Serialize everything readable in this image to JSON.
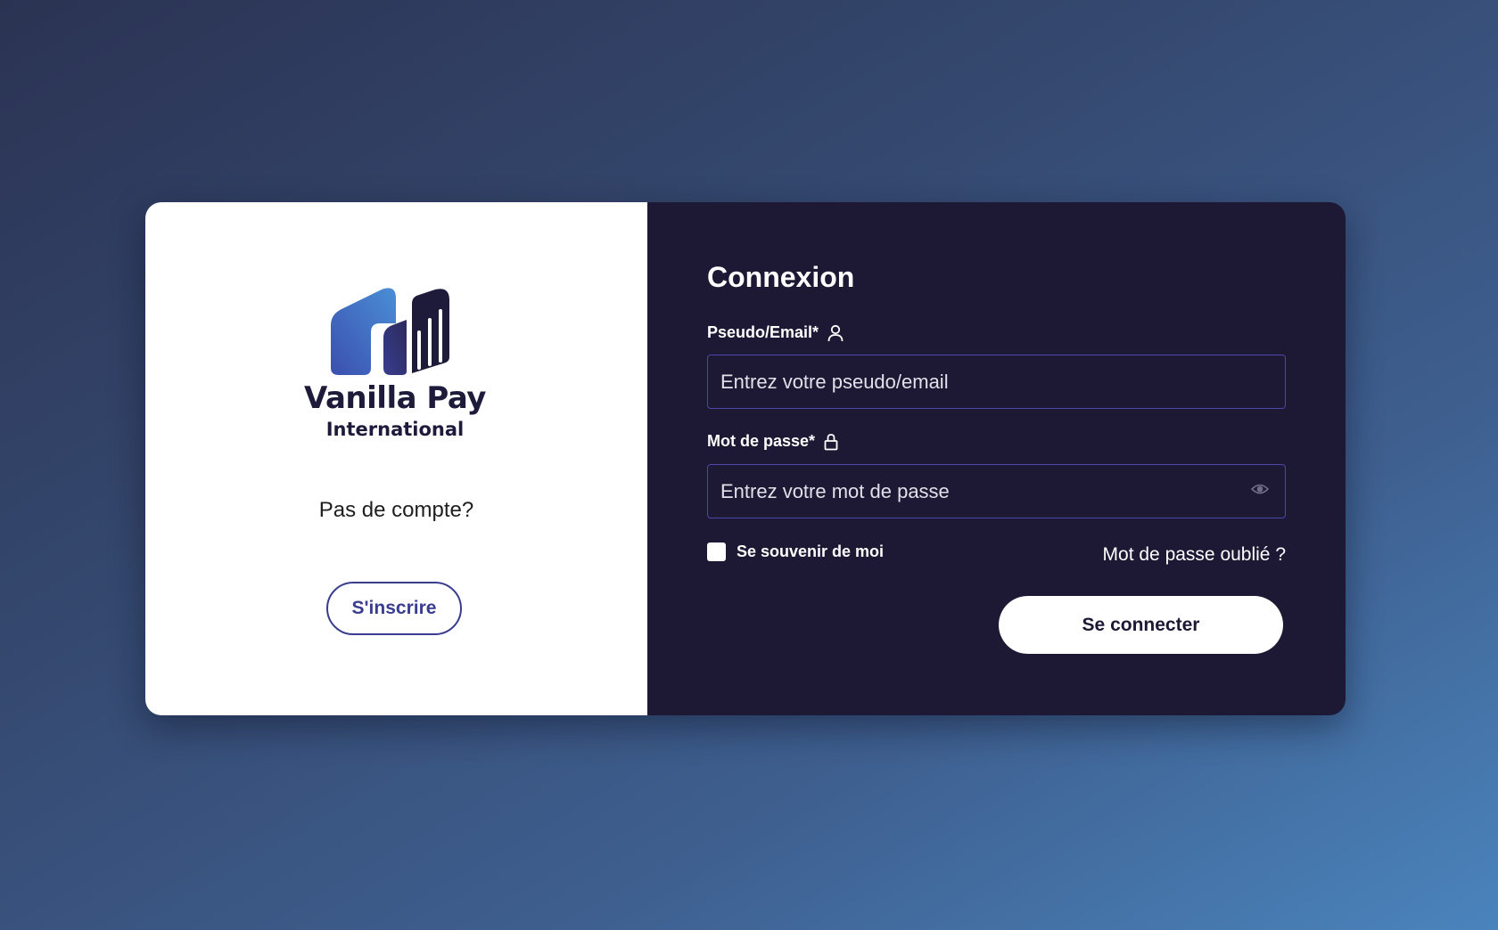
{
  "brand": {
    "name": "Vanilla Pay",
    "subtitle": "International",
    "logo_icon": "bar-chart-logo-icon"
  },
  "signup_panel": {
    "prompt": "Pas de compte?",
    "signup_label": "S'inscrire"
  },
  "login": {
    "title": "Connexion",
    "username_label": "Pseudo/Email*",
    "username_icon": "user-icon",
    "username_value": "",
    "username_placeholder": "Entrez votre pseudo/email",
    "password_label": "Mot de passe*",
    "password_icon": "lock-icon",
    "password_value": "",
    "password_placeholder": "Entrez votre mot de passe",
    "toggle_visibility_icon": "eye-icon",
    "remember_label": "Se souvenir de moi",
    "remember_checked": false,
    "forgot_label": "Mot de passe oublié ?",
    "submit_label": "Se connecter"
  },
  "colors": {
    "panel_dark": "#1d1833",
    "accent": "#3a3d8f",
    "field_border": "#4a48a8",
    "logo_gradient_start": "#3b4fae",
    "logo_gradient_end": "#4a8fd6",
    "logo_dark": "#1e1a3a"
  }
}
